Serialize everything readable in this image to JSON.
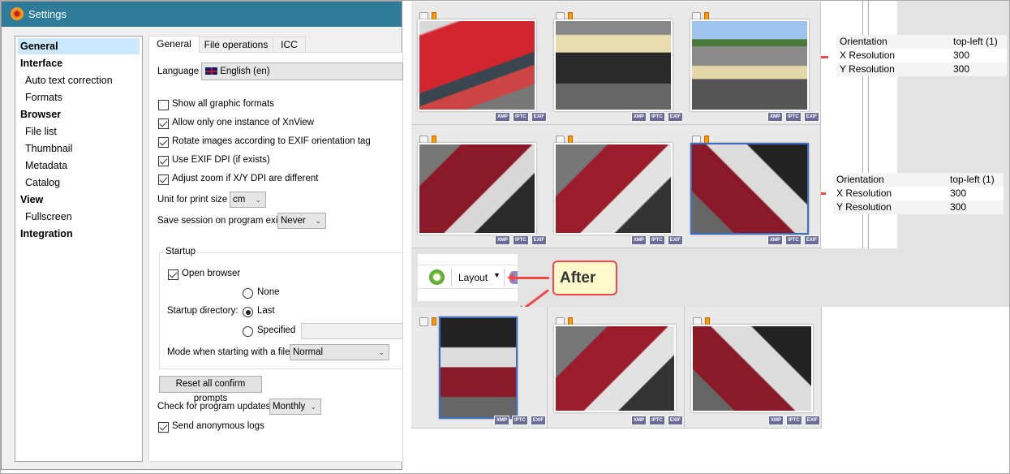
{
  "settings": {
    "title": "Settings",
    "sidebar": [
      {
        "label": "General",
        "bold": true,
        "selected": true
      },
      {
        "label": "Interface",
        "bold": true
      },
      {
        "label": "Auto text correction"
      },
      {
        "label": "Formats"
      },
      {
        "label": "Browser",
        "bold": true
      },
      {
        "label": "File list"
      },
      {
        "label": "Thumbnail"
      },
      {
        "label": "Metadata"
      },
      {
        "label": "Catalog"
      },
      {
        "label": "View",
        "bold": true
      },
      {
        "label": "Fullscreen"
      },
      {
        "label": "Integration",
        "bold": true
      }
    ],
    "tabs": [
      "General",
      "File operations",
      "ICC"
    ],
    "language_label": "Language",
    "language_value": "English (en)",
    "checks": [
      {
        "label": "Show all graphic formats",
        "checked": false
      },
      {
        "label": "Allow only one instance of XnView",
        "checked": true
      },
      {
        "label": "Rotate images according to EXIF orientation tag",
        "checked": true
      },
      {
        "label": "Use EXIF DPI (if exists)",
        "checked": true
      },
      {
        "label": "Adjust zoom if X/Y DPI are different",
        "checked": true
      }
    ],
    "unit_label": "Unit for print size",
    "unit_value": "cm",
    "session_label": "Save session on program exit",
    "session_value": "Never",
    "startup": {
      "title": "Startup",
      "open_browser": "Open browser",
      "dir_label": "Startup directory:",
      "radios": [
        "None",
        "Last",
        "Specified"
      ],
      "selected": "Last",
      "mode_label": "Mode when starting with a file",
      "mode_value": "Normal"
    },
    "reset_label": "Reset all confirm prompts",
    "updates_label": "Check for program updates",
    "updates_value": "Monthly",
    "logs_label": "Send anonymous logs"
  },
  "browser": {
    "tags": [
      "XMP",
      "IPTC",
      "EXIF"
    ],
    "metadata": [
      {
        "label": "Orientation",
        "value": "top-left (1)"
      },
      {
        "label": "X Resolution",
        "value": "300"
      },
      {
        "label": "Y Resolution",
        "value": "300"
      }
    ],
    "layout_label": "Layout",
    "callout": "After",
    "colors": {
      "accent": "#2e7b9a",
      "callout_border": "#f04848",
      "callout_fill": "#fff9cc",
      "selection": "#3c6fc4"
    }
  }
}
